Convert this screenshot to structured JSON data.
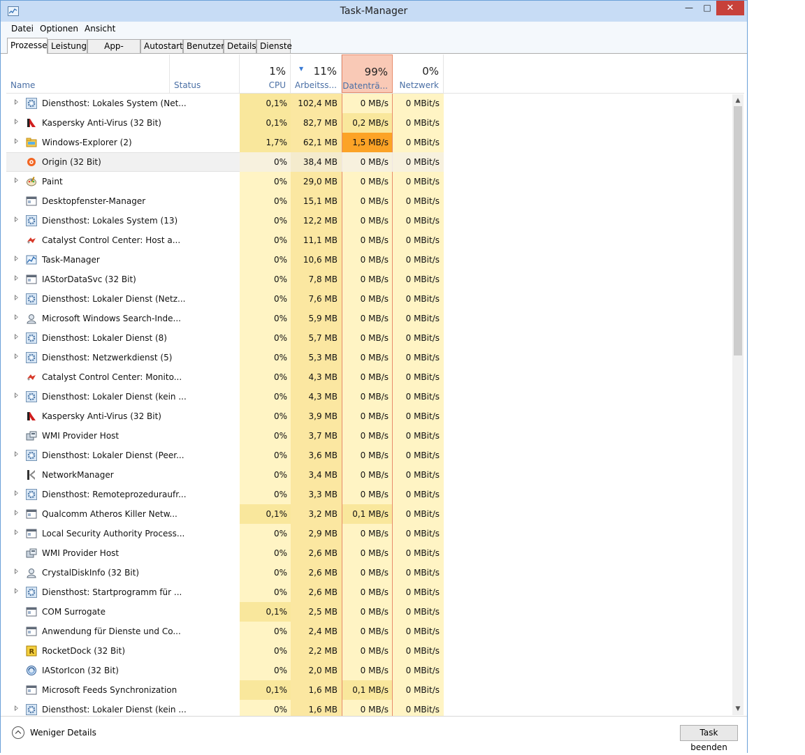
{
  "window": {
    "title": "Task-Manager"
  },
  "menu": [
    "Datei",
    "Optionen",
    "Ansicht"
  ],
  "tabs": [
    "Prozesse",
    "Leistung",
    "App-Verlauf",
    "Autostart",
    "Benutzer",
    "Details",
    "Dienste"
  ],
  "active_tab": "Prozesse",
  "columns": {
    "name": "Name",
    "status": "Status",
    "cpu": {
      "pct": "1%",
      "label": "CPU"
    },
    "memory": {
      "pct": "11%",
      "label": "Arbeitss..."
    },
    "disk": {
      "pct": "99%",
      "label": "Datenträ..."
    },
    "network": {
      "pct": "0%",
      "label": "Netzwerk"
    }
  },
  "colors": {
    "cell_light": "#fff4c4",
    "cell_mid": "#f9ecb0",
    "mem_col": "#fbe7a1",
    "cpu_hot": "#f9e79c",
    "disk_warm": "#f9e79c",
    "disk_hot": "#fca326",
    "disk_header": "#f9c9b6"
  },
  "processes": [
    {
      "name": "Diensthost: Lokales System (Net...",
      "icon": "service-gear",
      "expand": true,
      "cpu": "0,1%",
      "mem": "102,4 MB",
      "disk": "0 MB/s",
      "net": "0 MBit/s",
      "cpuLevel": 1,
      "diskLevel": 0
    },
    {
      "name": "Kaspersky Anti-Virus (32 Bit)",
      "icon": "kaspersky",
      "expand": true,
      "cpu": "0,1%",
      "mem": "82,7 MB",
      "disk": "0,2 MB/s",
      "net": "0 MBit/s",
      "cpuLevel": 1,
      "diskLevel": 1
    },
    {
      "name": "Windows-Explorer (2)",
      "icon": "explorer-folder",
      "expand": true,
      "cpu": "1,7%",
      "mem": "62,1 MB",
      "disk": "1,5 MB/s",
      "net": "0 MBit/s",
      "cpuLevel": 1,
      "diskLevel": 2
    },
    {
      "name": "Origin (32 Bit)",
      "icon": "origin",
      "expand": false,
      "cpu": "0%",
      "mem": "38,4 MB",
      "disk": "0 MB/s",
      "net": "0 MBit/s",
      "cpuLevel": 0,
      "diskLevel": 0,
      "selected": true
    },
    {
      "name": "Paint",
      "icon": "paint",
      "expand": true,
      "cpu": "0%",
      "mem": "29,0 MB",
      "disk": "0 MB/s",
      "net": "0 MBit/s",
      "cpuLevel": 0,
      "diskLevel": 0
    },
    {
      "name": "Desktopfenster-Manager",
      "icon": "window-app",
      "expand": false,
      "cpu": "0%",
      "mem": "15,1 MB",
      "disk": "0 MB/s",
      "net": "0 MBit/s",
      "cpuLevel": 0,
      "diskLevel": 0
    },
    {
      "name": "Diensthost: Lokales System (13)",
      "icon": "service-gear",
      "expand": true,
      "cpu": "0%",
      "mem": "12,2 MB",
      "disk": "0 MB/s",
      "net": "0 MBit/s",
      "cpuLevel": 0,
      "diskLevel": 0
    },
    {
      "name": "Catalyst Control Center: Host a...",
      "icon": "catalyst",
      "expand": false,
      "cpu": "0%",
      "mem": "11,1 MB",
      "disk": "0 MB/s",
      "net": "0 MBit/s",
      "cpuLevel": 0,
      "diskLevel": 0
    },
    {
      "name": "Task-Manager",
      "icon": "taskmanager",
      "expand": true,
      "cpu": "0%",
      "mem": "10,6 MB",
      "disk": "0 MB/s",
      "net": "0 MBit/s",
      "cpuLevel": 0,
      "diskLevel": 0
    },
    {
      "name": "IAStorDataSvc (32 Bit)",
      "icon": "window-app",
      "expand": true,
      "cpu": "0%",
      "mem": "7,8 MB",
      "disk": "0 MB/s",
      "net": "0 MBit/s",
      "cpuLevel": 0,
      "diskLevel": 0
    },
    {
      "name": "Diensthost: Lokaler Dienst (Netz...",
      "icon": "service-gear",
      "expand": true,
      "cpu": "0%",
      "mem": "7,6 MB",
      "disk": "0 MB/s",
      "net": "0 MBit/s",
      "cpuLevel": 0,
      "diskLevel": 0
    },
    {
      "name": "Microsoft Windows Search-Inde...",
      "icon": "search-user",
      "expand": true,
      "cpu": "0%",
      "mem": "5,9 MB",
      "disk": "0 MB/s",
      "net": "0 MBit/s",
      "cpuLevel": 0,
      "diskLevel": 0
    },
    {
      "name": "Diensthost: Lokaler Dienst (8)",
      "icon": "service-gear",
      "expand": true,
      "cpu": "0%",
      "mem": "5,7 MB",
      "disk": "0 MB/s",
      "net": "0 MBit/s",
      "cpuLevel": 0,
      "diskLevel": 0
    },
    {
      "name": "Diensthost: Netzwerkdienst (5)",
      "icon": "service-gear",
      "expand": true,
      "cpu": "0%",
      "mem": "5,3 MB",
      "disk": "0 MB/s",
      "net": "0 MBit/s",
      "cpuLevel": 0,
      "diskLevel": 0
    },
    {
      "name": "Catalyst Control Center: Monito...",
      "icon": "catalyst",
      "expand": false,
      "cpu": "0%",
      "mem": "4,3 MB",
      "disk": "0 MB/s",
      "net": "0 MBit/s",
      "cpuLevel": 0,
      "diskLevel": 0
    },
    {
      "name": "Diensthost: Lokaler Dienst (kein ...",
      "icon": "service-gear",
      "expand": true,
      "cpu": "0%",
      "mem": "4,3 MB",
      "disk": "0 MB/s",
      "net": "0 MBit/s",
      "cpuLevel": 0,
      "diskLevel": 0
    },
    {
      "name": "Kaspersky Anti-Virus (32 Bit)",
      "icon": "kaspersky",
      "expand": false,
      "cpu": "0%",
      "mem": "3,9 MB",
      "disk": "0 MB/s",
      "net": "0 MBit/s",
      "cpuLevel": 0,
      "diskLevel": 0
    },
    {
      "name": "WMI Provider Host",
      "icon": "wmi",
      "expand": false,
      "cpu": "0%",
      "mem": "3,7 MB",
      "disk": "0 MB/s",
      "net": "0 MBit/s",
      "cpuLevel": 0,
      "diskLevel": 0
    },
    {
      "name": "Diensthost: Lokaler Dienst (Peer...",
      "icon": "service-gear",
      "expand": true,
      "cpu": "0%",
      "mem": "3,6 MB",
      "disk": "0 MB/s",
      "net": "0 MBit/s",
      "cpuLevel": 0,
      "diskLevel": 0
    },
    {
      "name": "NetworkManager",
      "icon": "networkmanager",
      "expand": false,
      "cpu": "0%",
      "mem": "3,4 MB",
      "disk": "0 MB/s",
      "net": "0 MBit/s",
      "cpuLevel": 0,
      "diskLevel": 0
    },
    {
      "name": "Diensthost: Remoteprozeduraufr...",
      "icon": "service-gear",
      "expand": true,
      "cpu": "0%",
      "mem": "3,3 MB",
      "disk": "0 MB/s",
      "net": "0 MBit/s",
      "cpuLevel": 0,
      "diskLevel": 0
    },
    {
      "name": "Qualcomm Atheros Killer Netw...",
      "icon": "window-app",
      "expand": true,
      "cpu": "0,1%",
      "mem": "3,2 MB",
      "disk": "0,1 MB/s",
      "net": "0 MBit/s",
      "cpuLevel": 1,
      "diskLevel": 1
    },
    {
      "name": "Local Security Authority Process...",
      "icon": "window-app",
      "expand": true,
      "cpu": "0%",
      "mem": "2,9 MB",
      "disk": "0 MB/s",
      "net": "0 MBit/s",
      "cpuLevel": 0,
      "diskLevel": 0
    },
    {
      "name": "WMI Provider Host",
      "icon": "wmi",
      "expand": false,
      "cpu": "0%",
      "mem": "2,6 MB",
      "disk": "0 MB/s",
      "net": "0 MBit/s",
      "cpuLevel": 0,
      "diskLevel": 0
    },
    {
      "name": "CrystalDiskInfo (32 Bit)",
      "icon": "search-user",
      "expand": true,
      "cpu": "0%",
      "mem": "2,6 MB",
      "disk": "0 MB/s",
      "net": "0 MBit/s",
      "cpuLevel": 0,
      "diskLevel": 0
    },
    {
      "name": "Diensthost: Startprogramm für ...",
      "icon": "service-gear",
      "expand": true,
      "cpu": "0%",
      "mem": "2,6 MB",
      "disk": "0 MB/s",
      "net": "0 MBit/s",
      "cpuLevel": 0,
      "diskLevel": 0
    },
    {
      "name": "COM Surrogate",
      "icon": "window-app",
      "expand": false,
      "cpu": "0,1%",
      "mem": "2,5 MB",
      "disk": "0 MB/s",
      "net": "0 MBit/s",
      "cpuLevel": 1,
      "diskLevel": 0
    },
    {
      "name": "Anwendung für Dienste und Co...",
      "icon": "window-app",
      "expand": false,
      "cpu": "0%",
      "mem": "2,4 MB",
      "disk": "0 MB/s",
      "net": "0 MBit/s",
      "cpuLevel": 0,
      "diskLevel": 0
    },
    {
      "name": "RocketDock (32 Bit)",
      "icon": "rocketdock",
      "expand": false,
      "cpu": "0%",
      "mem": "2,2 MB",
      "disk": "0 MB/s",
      "net": "0 MBit/s",
      "cpuLevel": 0,
      "diskLevel": 0
    },
    {
      "name": "IAStorIcon (32 Bit)",
      "icon": "iastor",
      "expand": false,
      "cpu": "0%",
      "mem": "2,0 MB",
      "disk": "0 MB/s",
      "net": "0 MBit/s",
      "cpuLevel": 0,
      "diskLevel": 0
    },
    {
      "name": "Microsoft Feeds Synchronization",
      "icon": "window-app",
      "expand": false,
      "cpu": "0,1%",
      "mem": "1,6 MB",
      "disk": "0,1 MB/s",
      "net": "0 MBit/s",
      "cpuLevel": 1,
      "diskLevel": 1
    },
    {
      "name": "Diensthost: Lokaler Dienst (kein ...",
      "icon": "service-gear",
      "expand": true,
      "cpu": "0%",
      "mem": "1,6 MB",
      "disk": "0 MB/s",
      "net": "0 MBit/s",
      "cpuLevel": 0,
      "diskLevel": 0
    }
  ],
  "footer": {
    "fewer_details": "Weniger Details",
    "end_task": "Task beenden"
  }
}
